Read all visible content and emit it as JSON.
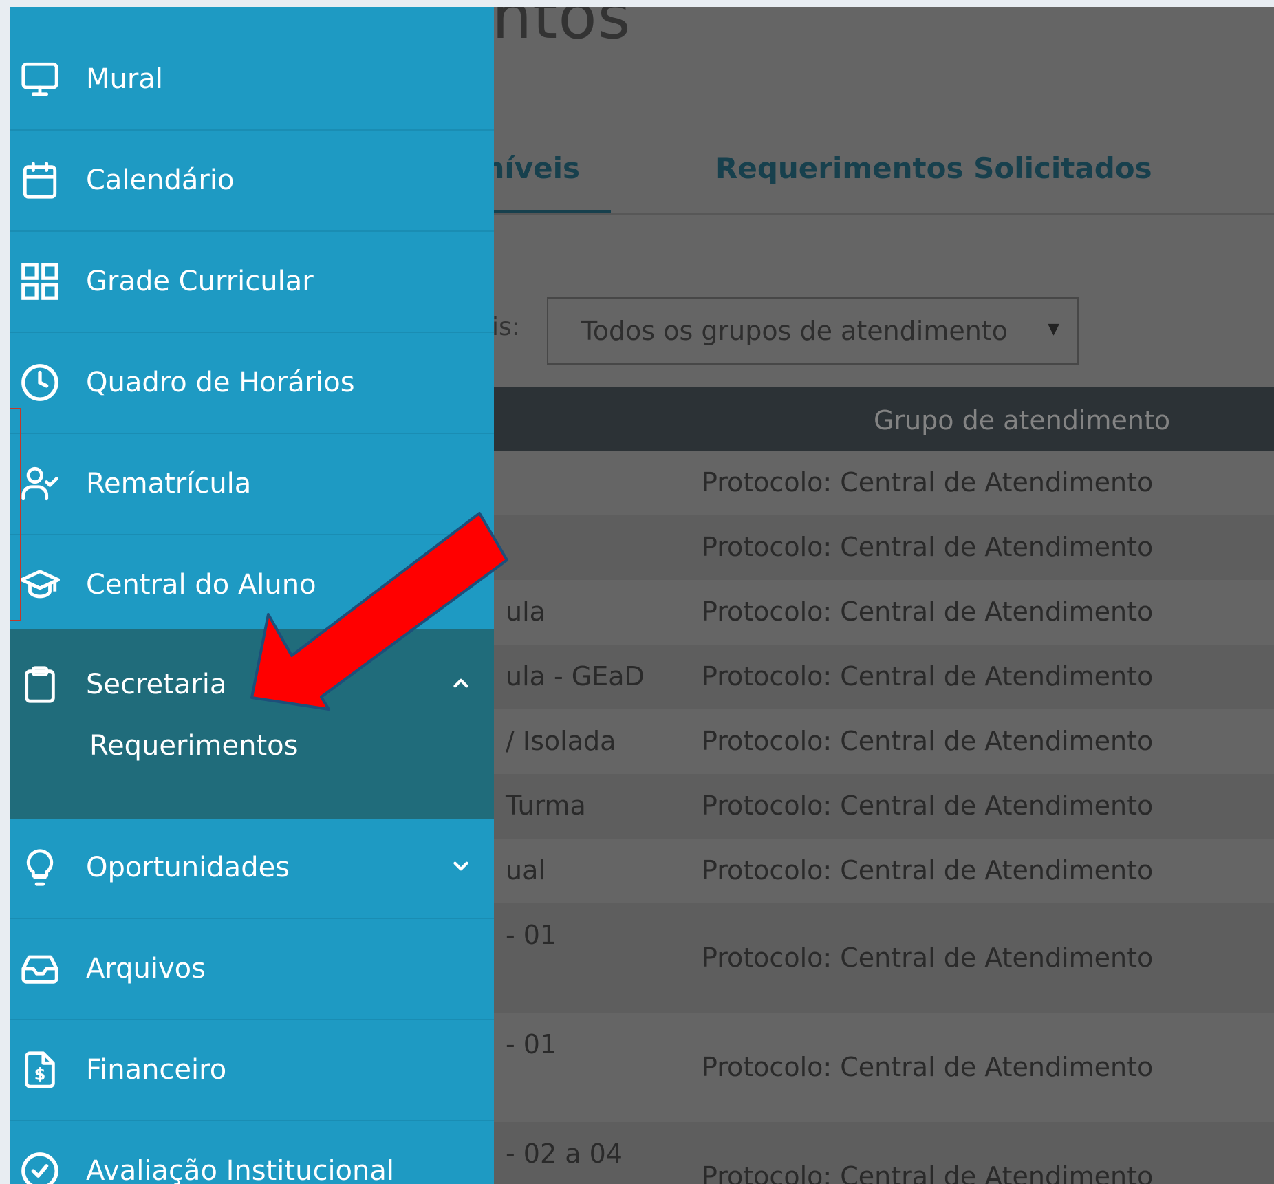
{
  "page": {
    "title_fragment": "ntos",
    "tabs": [
      {
        "label": "níveis",
        "active": true
      },
      {
        "label": "Requerimentos Solicitados",
        "active": false
      }
    ],
    "filter_label_fragment": "is:",
    "group_select": {
      "value": "Todos os grupos de atendimento"
    },
    "table": {
      "column_header": "Grupo de atendimento",
      "rows": [
        {
          "c1": "",
          "group": "Protocolo: Central de Atendimento"
        },
        {
          "c1": "",
          "group": "Protocolo: Central de Atendimento"
        },
        {
          "c1": "ula",
          "group": "Protocolo: Central de Atendimento"
        },
        {
          "c1": "ula - GEaD",
          "group": "Protocolo: Central de Atendimento"
        },
        {
          "c1": "/ Isolada",
          "group": "Protocolo: Central de Atendimento"
        },
        {
          "c1": "Turma",
          "group": "Protocolo: Central de Atendimento"
        },
        {
          "c1": "ual",
          "group": "Protocolo: Central de Atendimento"
        },
        {
          "c1": "- 01",
          "group": "Protocolo: Central de Atendimento"
        },
        {
          "c1": "- 01",
          "group": "Protocolo: Central de Atendimento"
        },
        {
          "c1": "- 02 a 04",
          "group": "Protocolo: Central de Atendimento"
        }
      ]
    }
  },
  "sidebar": {
    "items": [
      {
        "label": "Mural",
        "icon": "monitor-icon"
      },
      {
        "label": "Calendário",
        "icon": "calendar-icon"
      },
      {
        "label": "Grade Curricular",
        "icon": "grid-icon"
      },
      {
        "label": "Quadro de Horários",
        "icon": "clock-icon"
      },
      {
        "label": "Rematrícula",
        "icon": "user-check-icon"
      },
      {
        "label": "Central do Aluno",
        "icon": "graduation-cap-icon"
      },
      {
        "label": "Secretaria",
        "icon": "clipboard-icon",
        "expanded": true,
        "sub_items": [
          "Requerimentos"
        ]
      },
      {
        "label": "Oportunidades",
        "icon": "lightbulb-icon",
        "expanded": false
      },
      {
        "label": "Arquivos",
        "icon": "inbox-icon"
      },
      {
        "label": "Financeiro",
        "icon": "dollar-file-icon"
      },
      {
        "label": "Avaliação Institucional",
        "icon": "check-circle-icon"
      }
    ]
  },
  "colors": {
    "sidebar_bg": "#1e9ac3",
    "sidebar_active_bg": "#206c7b",
    "overlay_dim": "#656565",
    "table_header_bg": "#2c3236",
    "tab_text": "#17404d",
    "annotation_arrow": "#ff0000"
  }
}
